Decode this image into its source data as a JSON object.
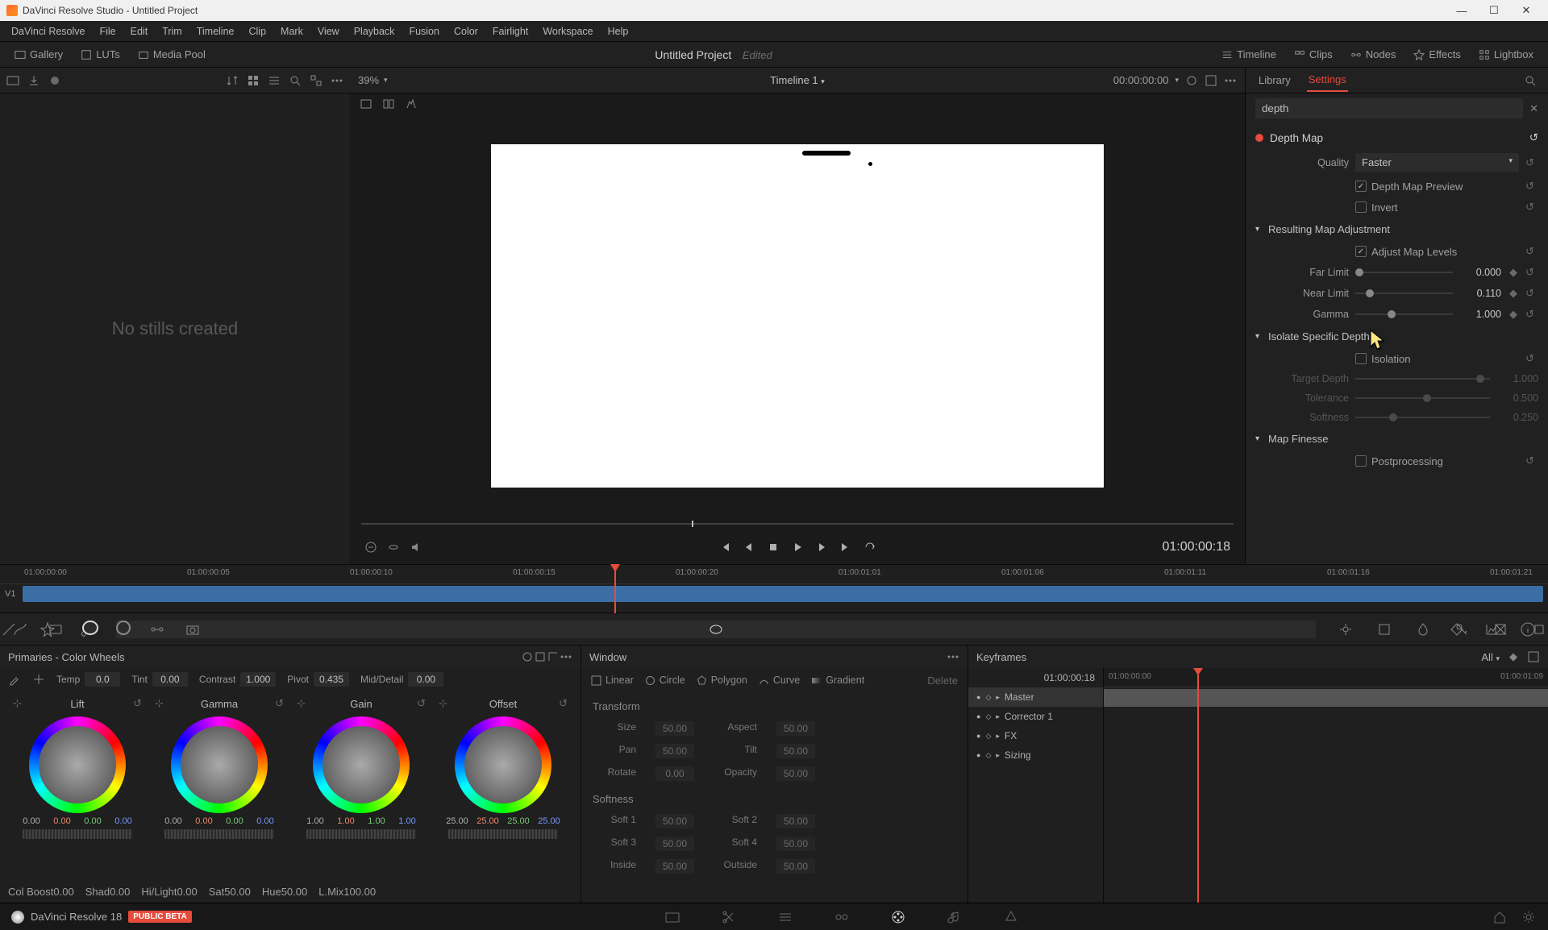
{
  "window": {
    "title": "DaVinci Resolve Studio - Untitled Project"
  },
  "menu": [
    "DaVinci Resolve",
    "File",
    "Edit",
    "Trim",
    "Timeline",
    "Clip",
    "Mark",
    "View",
    "Playback",
    "Fusion",
    "Color",
    "Fairlight",
    "Workspace",
    "Help"
  ],
  "toolbar1": {
    "left": [
      {
        "name": "gallery",
        "label": "Gallery"
      },
      {
        "name": "luts",
        "label": "LUTs"
      },
      {
        "name": "mediapool",
        "label": "Media Pool"
      }
    ],
    "project": "Untitled Project",
    "edited": "Edited",
    "right": [
      {
        "name": "timeline",
        "label": "Timeline"
      },
      {
        "name": "clips",
        "label": "Clips"
      },
      {
        "name": "nodes",
        "label": "Nodes"
      },
      {
        "name": "effects",
        "label": "Effects"
      },
      {
        "name": "lightbox",
        "label": "Lightbox"
      }
    ]
  },
  "viewer": {
    "zoom": "39%",
    "timeline_name": "Timeline 1",
    "tc_in": "00:00:00:00",
    "tc_current": "01:00:00:18"
  },
  "gallery_empty": "No stills created",
  "right_tabs": {
    "library": "Library",
    "settings": "Settings"
  },
  "search": {
    "query": "depth"
  },
  "depthmap": {
    "title": "Depth Map",
    "quality_label": "Quality",
    "quality_value": "Faster",
    "preview_label": "Depth Map Preview",
    "invert_label": "Invert",
    "adjust_section": "Resulting Map Adjustment",
    "adjust_levels_label": "Adjust Map Levels",
    "far_limit_label": "Far Limit",
    "far_limit_value": "0.000",
    "near_limit_label": "Near Limit",
    "near_limit_value": "0.110",
    "gamma_label": "Gamma",
    "gamma_value": "1.000",
    "isolate_section": "Isolate Specific Depth",
    "isolation_label": "Isolation",
    "target_depth_label": "Target Depth",
    "target_depth_value": "1.000",
    "tolerance_label": "Tolerance",
    "tolerance_value": "0.500",
    "softness_label": "Softness",
    "softness_value": "0.250",
    "finesse_section": "Map Finesse",
    "postproc_label": "Postprocessing"
  },
  "timeline": {
    "ticks": [
      "01:00:00:00",
      "01:00:00:05",
      "01:00:00:10",
      "01:00:00:15",
      "01:00:00:20",
      "01:00:01:01",
      "01:00:01:06",
      "01:00:01:11",
      "01:00:01:16",
      "01:00:01:21"
    ],
    "track": "V1"
  },
  "primaries": {
    "title": "Primaries - Color Wheels",
    "top_adjust": [
      {
        "l": "Temp",
        "v": "0.0"
      },
      {
        "l": "Tint",
        "v": "0.00"
      },
      {
        "l": "Contrast",
        "v": "1.000"
      },
      {
        "l": "Pivot",
        "v": "0.435"
      },
      {
        "l": "Mid/Detail",
        "v": "0.00"
      }
    ],
    "wheels": [
      {
        "name": "Lift",
        "vals": [
          "0.00",
          "0.00",
          "0.00",
          "0.00"
        ]
      },
      {
        "name": "Gamma",
        "vals": [
          "0.00",
          "0.00",
          "0.00",
          "0.00"
        ]
      },
      {
        "name": "Gain",
        "vals": [
          "1.00",
          "1.00",
          "1.00",
          "1.00"
        ]
      },
      {
        "name": "Offset",
        "vals": [
          "25.00",
          "25.00",
          "25.00",
          "25.00"
        ]
      }
    ],
    "bottom_adjust": [
      {
        "l": "Col Boost",
        "v": "0.00"
      },
      {
        "l": "Shad",
        "v": "0.00"
      },
      {
        "l": "Hi/Light",
        "v": "0.00"
      },
      {
        "l": "Sat",
        "v": "50.00"
      },
      {
        "l": "Hue",
        "v": "50.00"
      },
      {
        "l": "L.Mix",
        "v": "100.00"
      }
    ]
  },
  "window_panel": {
    "title": "Window",
    "shapes": [
      "Linear",
      "Circle",
      "Polygon",
      "Curve",
      "Gradient"
    ],
    "delete": "Delete",
    "transform_title": "Transform",
    "transform": [
      [
        {
          "l": "Size",
          "v": "50.00"
        },
        {
          "l": "Aspect",
          "v": "50.00"
        }
      ],
      [
        {
          "l": "Pan",
          "v": "50.00"
        },
        {
          "l": "Tilt",
          "v": "50.00"
        }
      ],
      [
        {
          "l": "Rotate",
          "v": "0.00"
        },
        {
          "l": "Opacity",
          "v": "50.00"
        }
      ]
    ],
    "softness_title": "Softness",
    "softness": [
      [
        {
          "l": "Soft 1",
          "v": "50.00"
        },
        {
          "l": "Soft 2",
          "v": "50.00"
        }
      ],
      [
        {
          "l": "Soft 3",
          "v": "50.00"
        },
        {
          "l": "Soft 4",
          "v": "50.00"
        }
      ],
      [
        {
          "l": "Inside",
          "v": "50.00"
        },
        {
          "l": "Outside",
          "v": "50.00"
        }
      ]
    ]
  },
  "keyframes": {
    "title": "Keyframes",
    "all": "All",
    "tc": "01:00:00:18",
    "ruler": [
      "01:00:00:00",
      "01:00:01:09"
    ],
    "tree": [
      {
        "name": "Master",
        "master": true
      },
      {
        "name": "Corrector 1"
      },
      {
        "name": "FX"
      },
      {
        "name": "Sizing"
      }
    ]
  },
  "footer": {
    "app": "DaVinci Resolve 18",
    "beta": "PUBLIC BETA"
  }
}
